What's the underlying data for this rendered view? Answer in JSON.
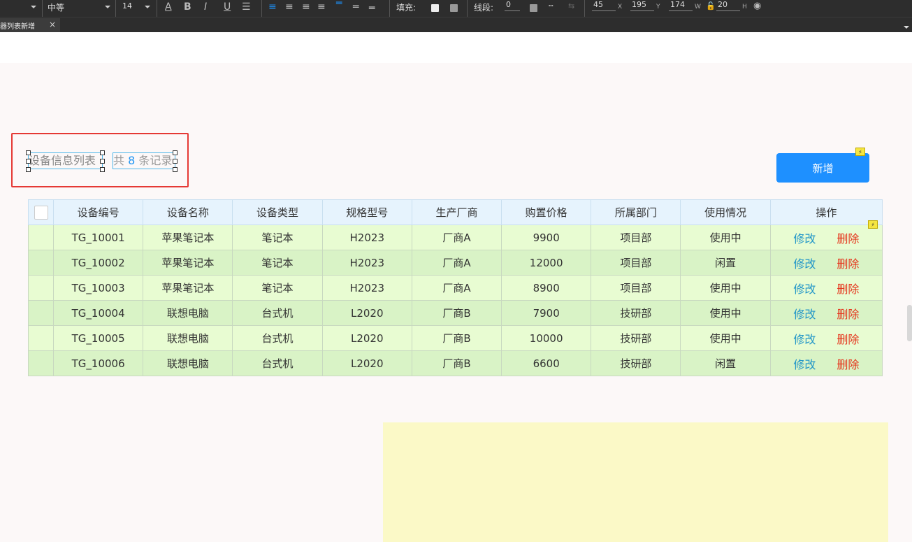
{
  "toolbar": {
    "font_weight": "中等",
    "font_size": "14",
    "fill_label": "填充:",
    "stroke_label": "线段:",
    "stroke_value": "0",
    "x_value": "45",
    "x_label": "X",
    "y_value": "195",
    "y_label": "Y",
    "w_value": "174",
    "w_label": "W",
    "h_value": "20",
    "h_label": "H"
  },
  "tab": {
    "label": "器列表新增",
    "close": "×"
  },
  "list": {
    "title": "设备信息列表",
    "count_prefix": "共",
    "count": "8",
    "count_suffix": "条记录"
  },
  "add_button": "新增",
  "table": {
    "headers": [
      "设备编号",
      "设备名称",
      "设备类型",
      "规格型号",
      "生产厂商",
      "购置价格",
      "所属部门",
      "使用情况",
      "操作"
    ],
    "rows": [
      [
        "TG_10001",
        "苹果笔记本",
        "笔记本",
        "H2023",
        "厂商A",
        "9900",
        "项目部",
        "使用中"
      ],
      [
        "TG_10002",
        "苹果笔记本",
        "笔记本",
        "H2023",
        "厂商A",
        "12000",
        "项目部",
        "闲置"
      ],
      [
        "TG_10003",
        "苹果笔记本",
        "笔记本",
        "H2023",
        "厂商A",
        "8900",
        "项目部",
        "使用中"
      ],
      [
        "TG_10004",
        "联想电脑",
        "台式机",
        "L2020",
        "厂商B",
        "7900",
        "技研部",
        "使用中"
      ],
      [
        "TG_10005",
        "联想电脑",
        "台式机",
        "L2020",
        "厂商B",
        "10000",
        "技研部",
        "使用中"
      ],
      [
        "TG_10006",
        "联想电脑",
        "台式机",
        "L2020",
        "厂商B",
        "6600",
        "技研部",
        "闲置"
      ]
    ],
    "edit_label": "修改",
    "delete_label": "删除"
  },
  "colors": {
    "accent": "#1e90ff",
    "selection_border": "#e53935",
    "edit": "#2196c8",
    "delete": "#e53920"
  }
}
